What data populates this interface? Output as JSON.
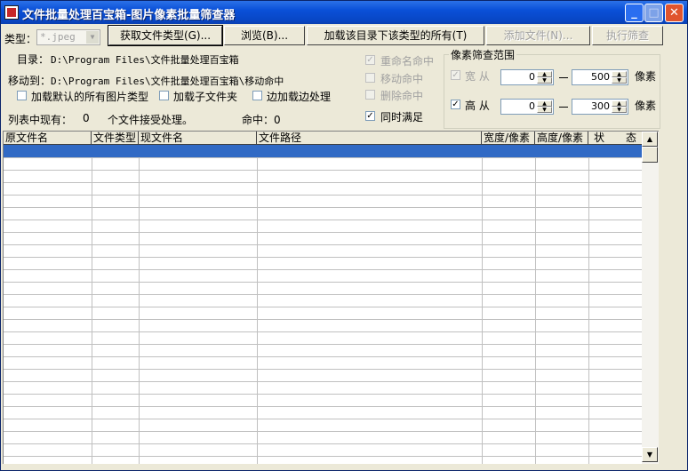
{
  "window": {
    "title": "文件批量处理百宝箱-图片像素批量筛查器",
    "minimize_label": "_",
    "maximize_label": "□",
    "close_label": "✕"
  },
  "toolbar": {
    "type_label": "类型：",
    "type_value": "*.jpeg",
    "get_types_button": "获取文件类型(G)...",
    "browse_button": "浏览(B)...",
    "load_all_button": "加载该目录下该类型的所有(T)",
    "add_file_button": "添加文件(N)...",
    "run_filter_button": "执行筛查"
  },
  "paths": {
    "dir_label": "目录：",
    "dir_value": "D:\\Program Files\\文件批量处理百宝箱",
    "move_label": "移动到：",
    "move_value": "D:\\Program Files\\文件批量处理百宝箱\\移动命中"
  },
  "options": {
    "load_default_types": "加载默认的所有图片类型",
    "load_subfolders": "加载子文件夹",
    "process_while_loading": "边加载边处理"
  },
  "status": {
    "list_count_label": "列表中现有：",
    "list_count_value": "0",
    "list_count_suffix": "个文件接受处理。",
    "hit_label": "命中：0"
  },
  "actions": {
    "rename_hit": "重命名命中",
    "move_hit": "移动命中",
    "delete_hit": "删除命中",
    "both_satisfy": "同时满足",
    "checked_mark": "✓"
  },
  "pixel_range": {
    "group_title": "像素筛查范围",
    "width_label": "宽 从",
    "width_from": "0",
    "width_to": "500",
    "height_label": "高 从",
    "height_from": "0",
    "height_to": "300",
    "unit": "像素",
    "up_arrow": "▲",
    "down_arrow": "▼"
  },
  "table": {
    "columns": [
      "原文件名",
      "文件类型",
      "现文件名",
      "文件路径",
      "宽度/像素",
      "高度/像素",
      "状　　态"
    ],
    "rows": []
  },
  "scrollbar": {
    "up_arrow": "▲",
    "down_arrow": "▼"
  }
}
